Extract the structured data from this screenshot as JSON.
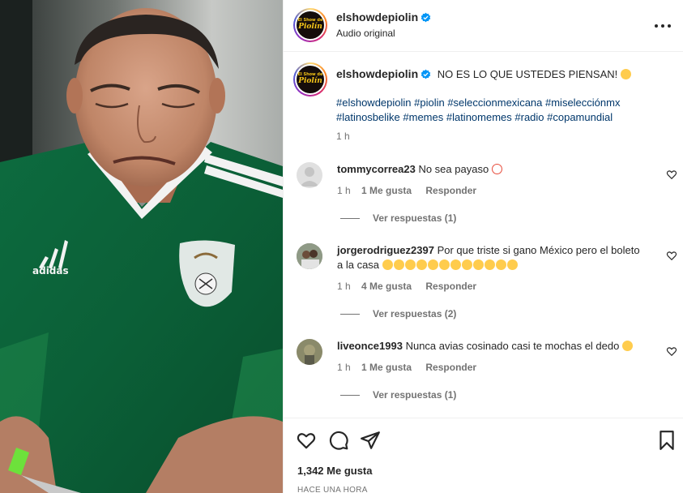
{
  "post": {
    "username": "elshowdepiolin",
    "audio_label": "Audio original",
    "logo_text_top": "El Show de",
    "logo_text_main": "Piolín",
    "caption": "NO ES LO QUE USTEDES PIENSAN!",
    "hashtags": "#elshowdepiolin #piolin #seleccionmexicana #miselecciónmx #latinosbelike #memes #latinomemes #radio #copamundial",
    "caption_time": "1 h",
    "likes": "1,342 Me gusta",
    "time_ago": "HACE UNA HORA"
  },
  "video": {
    "shirt_brand": "adidas"
  },
  "comments": [
    {
      "username": "tommycorrea23",
      "text": "No sea payaso",
      "time": "1 h",
      "likes": "1 Me gusta",
      "reply": "Responder",
      "view_replies": "Ver respuestas (1)"
    },
    {
      "username": "jorgerodriguez2397",
      "text": "Por que triste si gano México pero el boleto a la casa",
      "time": "1 h",
      "likes": "4 Me gusta",
      "reply": "Responder",
      "view_replies": "Ver respuestas (2)"
    },
    {
      "username": "liveonce1993",
      "text": "Nunca avias cosinado casi te mochas el dedo",
      "time": "1 h",
      "likes": "1 Me gusta",
      "reply": "Responder",
      "view_replies": "Ver respuestas (1)"
    }
  ],
  "icons": {
    "verified": "verified-badge-icon",
    "more": "more-options-icon",
    "like": "heart-icon",
    "comment": "comment-icon",
    "share": "share-icon",
    "save": "bookmark-icon"
  },
  "colors": {
    "verified": "#0095f6",
    "hashtag": "#00376b",
    "muted": "#737373"
  }
}
